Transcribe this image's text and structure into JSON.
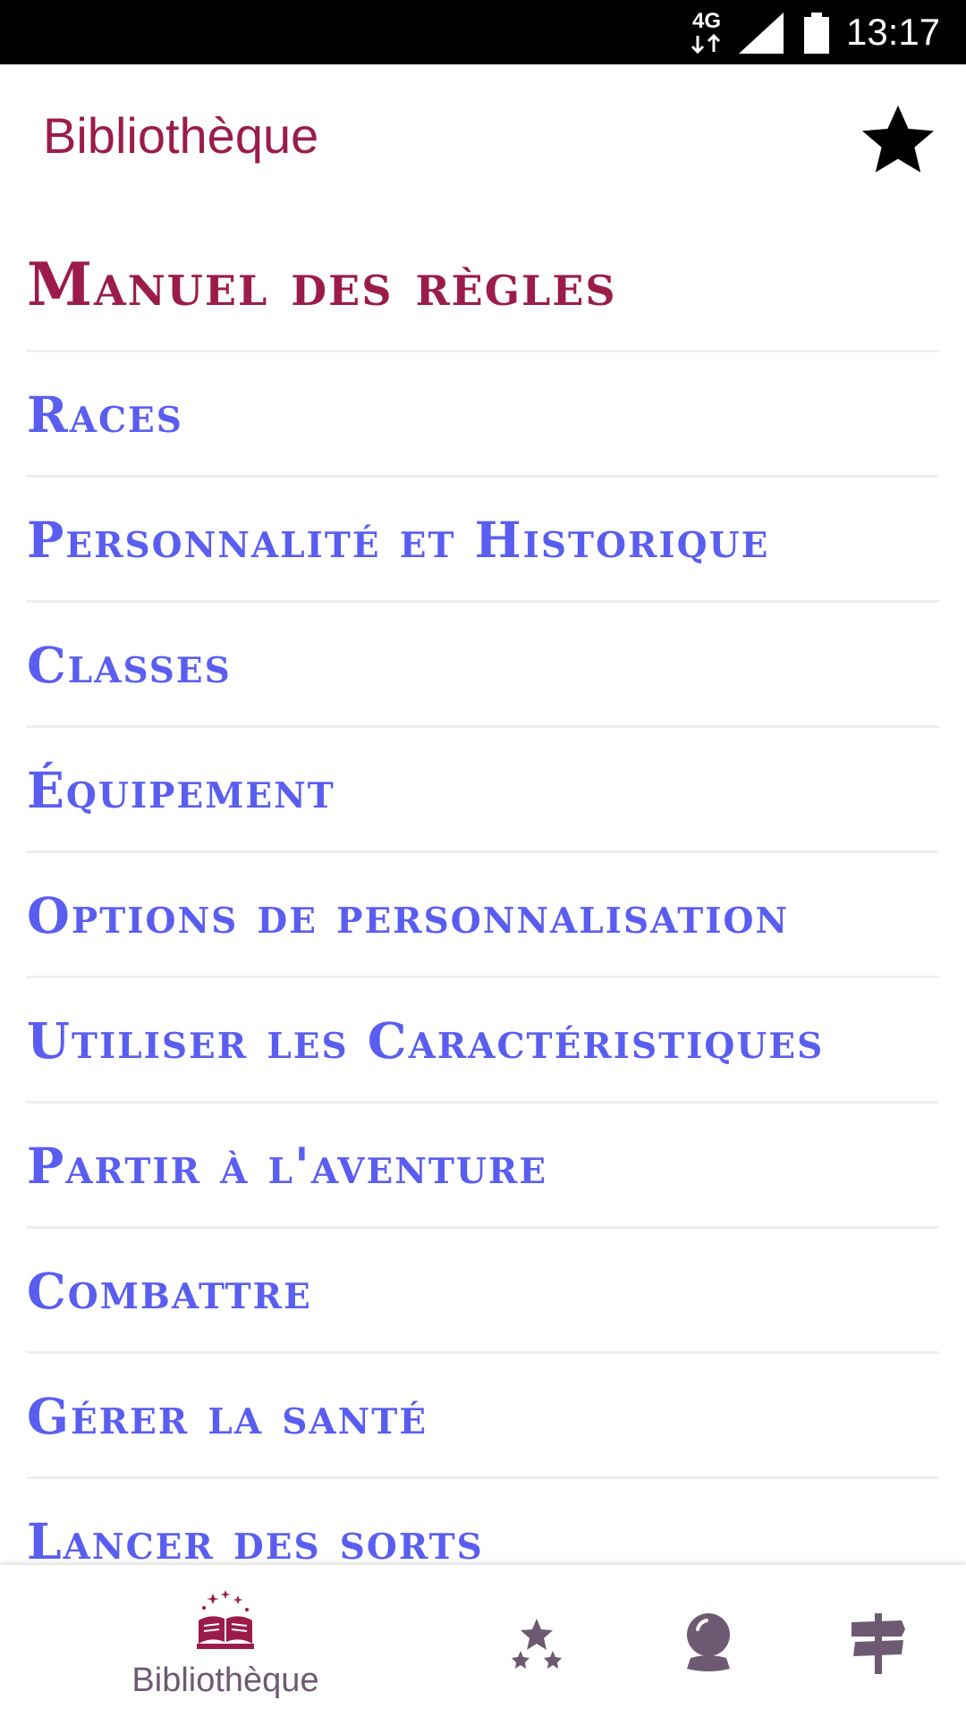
{
  "status_bar": {
    "network": "4G",
    "time": "13:17"
  },
  "app_bar": {
    "title": "Bibliothèque",
    "favorite_icon": "star-icon"
  },
  "section": {
    "heading": "Manuel des règles",
    "items": [
      {
        "label": "Races"
      },
      {
        "label": "Personnalité et Historique"
      },
      {
        "label": "Classes"
      },
      {
        "label": "Équipement"
      },
      {
        "label": "Options de personnalisation"
      },
      {
        "label": "Utiliser les Caractéristiques"
      },
      {
        "label": "Partir à l'aventure"
      },
      {
        "label": "Combattre"
      },
      {
        "label": "Gérer la santé"
      },
      {
        "label": "Lancer des sorts"
      }
    ]
  },
  "bottom_nav": {
    "items": [
      {
        "label": "Bibliothèque",
        "icon": "magic-book-icon",
        "active": true
      },
      {
        "icon": "stars-icon",
        "active": false
      },
      {
        "icon": "crystal-ball-icon",
        "active": false
      },
      {
        "icon": "signpost-icon",
        "active": false
      }
    ]
  },
  "colors": {
    "accent": "#9b1c4a",
    "link": "#5a5ef0",
    "nav_inactive": "#6d5a72"
  }
}
